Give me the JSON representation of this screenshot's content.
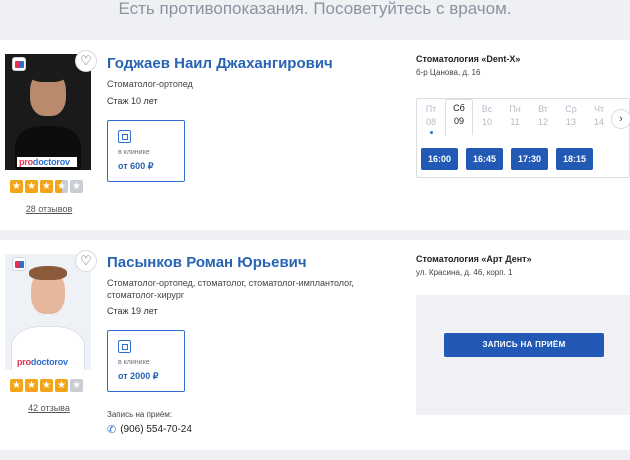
{
  "banner": {
    "text": "Есть противопоказания. Посоветуйтесь с врачом."
  },
  "doctors": [
    {
      "name": "Годжаев Наил Джахангирович",
      "specialty": "Стоматолог-ортопед",
      "experience": "Стаж 10 лет",
      "price_where": "в клинике",
      "price": "от 600 ₽",
      "rating": 3.5,
      "reviews": "28 отзывов",
      "clinic": "Стоматология «Dent-X»",
      "address": "б-р Цанова, д. 16",
      "days": [
        {
          "label": "Пт",
          "num": "08"
        },
        {
          "label": "Сб",
          "num": "09"
        },
        {
          "label": "Вс",
          "num": "10"
        },
        {
          "label": "Пн",
          "num": "11"
        },
        {
          "label": "Вт",
          "num": "12"
        },
        {
          "label": "Ср",
          "num": "13"
        },
        {
          "label": "Чт",
          "num": "14"
        }
      ],
      "slots": [
        "16:00",
        "16:45",
        "17:30",
        "18:15"
      ]
    },
    {
      "name": "Пасынков Роман Юрьевич",
      "specialty": "Стоматолог-ортопед, стоматолог, стоматолог-имплантолог, стоматолог-хирург",
      "experience": "Стаж 19 лет",
      "price_where": "в клинике",
      "price": "от 2000 ₽",
      "rating": 4,
      "reviews": "42 отзыва",
      "clinic": "Стоматология «Арт Дент»",
      "address": "ул. Красина, д. 46, корп. 1",
      "book_label": "ЗАПИСЬ НА ПРИЁМ",
      "phone_label": "Запись на приём:",
      "phone": "(906) 554-70-24"
    }
  ],
  "logo": {
    "pro": "pro",
    "doc": "doctorov"
  },
  "icons": {
    "favorite": "heart-icon",
    "clinic": "building-icon",
    "phone": "phone-icon",
    "next": "chevron-right-icon"
  },
  "colors": {
    "accent": "#2159b5",
    "link": "#2864b4",
    "star": "#f2a516"
  }
}
